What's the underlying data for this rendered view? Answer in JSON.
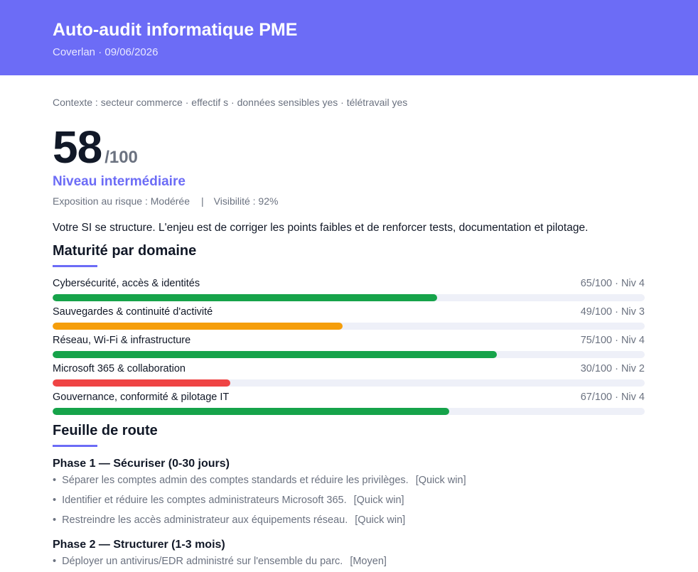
{
  "header": {
    "title": "Auto-audit informatique PME",
    "subtitle": "Coverlan · 09/06/2026"
  },
  "context": "Contexte : secteur commerce · effectif s · données sensibles yes · télétravail yes",
  "score": {
    "value": "58",
    "max": "/100",
    "level": "Niveau intermédiaire",
    "exposure": "Exposition au risque : Modérée",
    "separator": "|",
    "visibility": "Visibilité : 92%"
  },
  "summary": "Votre SI se structure. L'enjeu est de corriger les points faibles et de renforcer tests, documentation et pilotage.",
  "maturity": {
    "title": "Maturité par domaine",
    "domains": [
      {
        "label": "Cybersécurité, accès & identités",
        "score": "65/100 · Niv 4",
        "fraction": 0.65,
        "color": "#16a34a"
      },
      {
        "label": "Sauvegardes & continuité d'activité",
        "score": "49/100 · Niv 3",
        "fraction": 0.49,
        "color": "#f59e0b"
      },
      {
        "label": "Réseau, Wi-Fi & infrastructure",
        "score": "75/100 · Niv 4",
        "fraction": 0.75,
        "color": "#16a34a"
      },
      {
        "label": "Microsoft 365 & collaboration",
        "score": "30/100 · Niv 2",
        "fraction": 0.3,
        "color": "#ef4444"
      },
      {
        "label": "Gouvernance, conformité & pilotage IT",
        "score": "67/100 · Niv 4",
        "fraction": 0.67,
        "color": "#16a34a"
      }
    ]
  },
  "roadmap": {
    "title": "Feuille de route",
    "phase1": {
      "title": "Phase 1 — Sécuriser (0-30 jours)",
      "items": [
        {
          "bullet": "•",
          "text": "Séparer les comptes admin des comptes standards et réduire les privilèges.",
          "tag": "[Quick win]"
        },
        {
          "bullet": "•",
          "text": "Identifier et réduire les comptes administrateurs Microsoft 365.",
          "tag": "[Quick win]"
        },
        {
          "bullet": "•",
          "text": "Restreindre les accès administrateur aux équipements réseau.",
          "tag": "[Quick win]"
        }
      ]
    },
    "phase2": {
      "title": "Phase 2 — Structurer (1-3 mois)",
      "items": [
        {
          "bullet": "•",
          "text": "Déployer un antivirus/EDR administré sur l'ensemble du parc.",
          "tag": "[Moyen]"
        }
      ]
    }
  },
  "colors": {
    "accent": "#6c6cf6",
    "green": "#16a34a",
    "orange": "#f59e0b",
    "red": "#ef4444",
    "track": "#eef0f8"
  }
}
